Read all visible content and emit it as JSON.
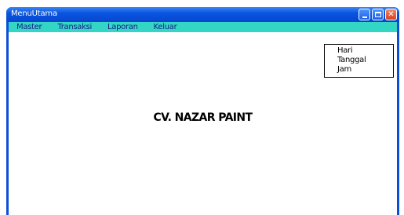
{
  "window": {
    "title": "MenuUtama",
    "controls": [
      "minimize-icon",
      "maximize-icon",
      "close-icon"
    ],
    "close_glyph": "✕"
  },
  "menu": {
    "items": [
      "Master",
      "Transaksi",
      "Laporan",
      "Keluar"
    ]
  },
  "info": {
    "day_label": "Hari",
    "date_label": "Tanggal",
    "time_label": "Jam"
  },
  "main": {
    "company_name": "CV. NAZAR PAINT"
  },
  "colors": {
    "titlebar": "#0a55e0",
    "menubar": "#33d6c4",
    "frame": "#0b4fd8",
    "close_button": "#d8421e"
  }
}
